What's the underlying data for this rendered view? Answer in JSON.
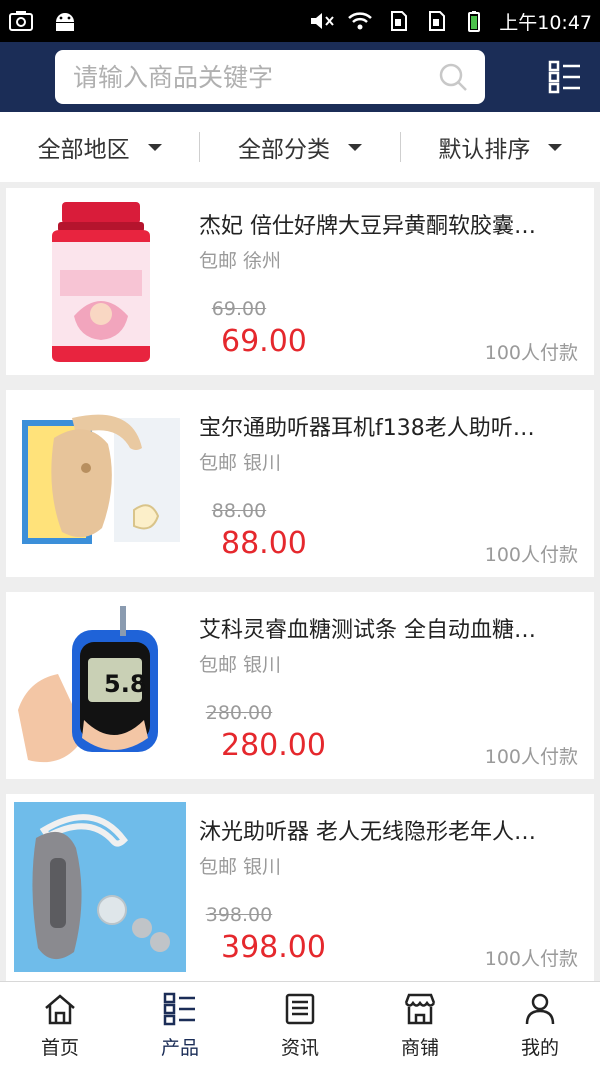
{
  "status_bar": {
    "time": "上午10:47"
  },
  "search": {
    "placeholder": "请输入商品关键字"
  },
  "filters": [
    {
      "label": "全部地区"
    },
    {
      "label": "全部分类"
    },
    {
      "label": "默认排序"
    }
  ],
  "products": [
    {
      "title": "杰妃 倍仕好牌大豆异黄酮软胶囊…",
      "shipping": "包邮",
      "location": "徐州",
      "old_price": "69.00",
      "price": "69.00",
      "sold": "100人付款"
    },
    {
      "title": "宝尔通助听器耳机f138老人助听…",
      "shipping": "包邮",
      "location": "银川",
      "old_price": "88.00",
      "price": "88.00",
      "sold": "100人付款"
    },
    {
      "title": "艾科灵睿血糖测试条 全自动血糖…",
      "shipping": "包邮",
      "location": "银川",
      "old_price": "280.00",
      "price": "280.00",
      "sold": "100人付款"
    },
    {
      "title": "沐光助听器 老人无线隐形老年人…",
      "shipping": "包邮",
      "location": "银川",
      "old_price": "398.00",
      "price": "398.00",
      "sold": "100人付款"
    }
  ],
  "tabs": [
    {
      "label": "首页",
      "icon": "home-icon"
    },
    {
      "label": "产品",
      "icon": "product-list-icon",
      "active": true
    },
    {
      "label": "资讯",
      "icon": "news-icon"
    },
    {
      "label": "商铺",
      "icon": "shop-icon"
    },
    {
      "label": "我的",
      "icon": "user-icon"
    }
  ],
  "colors": {
    "header": "#1b2d57",
    "price": "#e5282d",
    "muted": "#9a9a9a"
  },
  "product_images": [
    "supplement-bottle-image",
    "hearing-aid-image",
    "glucose-meter-image",
    "hearing-aid-image"
  ],
  "glucose_meter_reading": "5.8"
}
